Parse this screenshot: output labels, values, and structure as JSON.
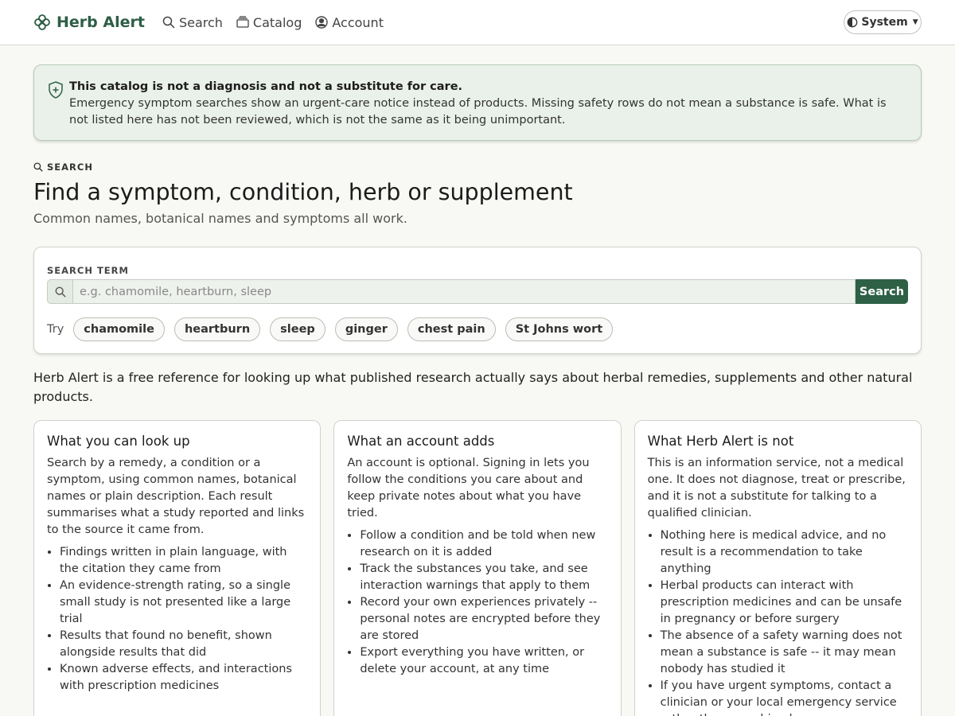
{
  "nav": {
    "brand": "Herb Alert",
    "links": [
      {
        "label": "Search",
        "icon": "search-icon"
      },
      {
        "label": "Catalog",
        "icon": "catalog-icon"
      },
      {
        "label": "Account",
        "icon": "account-icon"
      }
    ],
    "theme_label": "System"
  },
  "notice": {
    "title": "This catalog is not a diagnosis and not a substitute for care.",
    "body": "Emergency symptom searches show an urgent-care notice instead of products. Missing safety rows do not mean a substance is safe. What is not listed here has not been reviewed, which is not the same as it being unimportant."
  },
  "search_section": {
    "eyebrow": "SEARCH",
    "title": "Find a symptom, condition, herb or supplement",
    "subtitle": "Common names, botanical names and symptoms all work.",
    "field_label": "SEARCH TERM",
    "placeholder": "e.g. chamomile, heartburn, sleep",
    "value": "",
    "button": "Search",
    "try_label": "Try",
    "suggestions": [
      "chamomile",
      "heartburn",
      "sleep",
      "ginger",
      "chest pain",
      "St Johns wort"
    ]
  },
  "intro": "Herb Alert is a free reference for looking up what published research actually says about herbal remedies, supplements and other natural products.",
  "cards": [
    {
      "title": "What you can look up",
      "text": "Search by a remedy, a condition or a symptom, using common names, botanical names or plain description. Each result summarises what a study reported and links to the source it came from.",
      "items": [
        "Findings written in plain language, with the citation they came from",
        "An evidence-strength rating, so a single small study is not presented like a large trial",
        "Results that found no benefit, shown alongside results that did",
        "Known adverse effects, and interactions with prescription medicines"
      ]
    },
    {
      "title": "What an account adds",
      "text": "An account is optional. Signing in lets you follow the conditions you care about and keep private notes about what you have tried.",
      "items": [
        "Follow a condition and be told when new research on it is added",
        "Track the substances you take, and see interaction warnings that apply to them",
        "Record your own experiences privately -- personal notes are encrypted before they are stored",
        "Export everything you have written, or delete your account, at any time"
      ]
    },
    {
      "title": "What Herb Alert is not",
      "text": "This is an information service, not a medical one. It does not diagnose, treat or prescribe, and it is not a substitute for talking to a qualified clinician.",
      "items": [
        "Nothing here is medical advice, and no result is a recommendation to take anything",
        "Herbal products can interact with prescription medicines and can be unsafe in pregnancy or before surgery",
        "The absence of a safety warning does not mean a substance is safe -- it may mean nobody has studied it",
        "If you have urgent symptoms, contact a clinician or your local emergency service rather than searching here"
      ]
    }
  ],
  "colors": {
    "brand": "#2e5e45",
    "notice_bg": "#eaf1ea",
    "page_bg": "#f8f9f4",
    "button": "#2e6046"
  }
}
